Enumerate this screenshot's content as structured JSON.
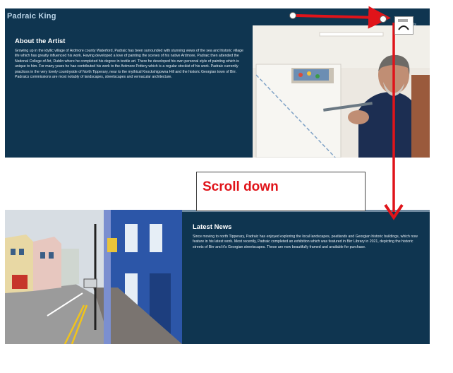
{
  "site": {
    "title": "Padraic King"
  },
  "nav": {
    "contact": "Contact Us"
  },
  "about": {
    "heading": "About the Artist",
    "text": "Growing up in the idyllic village of Ardmore county Waterford, Padraic has been surrounded with stunning views of the sea and historic village life which has greatly influenced his work. Having developed a love of painting the scenes of his native Ardmore, Padraic then attended the National College of Art, Dublin where he completed his degree in textile art. There he developed his own personal style of painting which is unique to him. For many years he has contributed his work to the Ardmore Pottery which is a regular stockist of his work. Padraic currently practices in the very lovely countryside of North Tipperary, near to the mythical Knockshigowna Hill and the historic Georgian town of Birr. Padraics commissions are most notably of landscapes, streetscapes and vernacular architecture."
  },
  "news": {
    "heading": "Latest News",
    "text": "Since moving to north Tipperary, Padraic has enjoyed exploring the local landscapes, peatlands and Georgian historic buildings, which now feature in his latest work. Most recently, Padraic completed an exhibition which was featured in Birr Library in 2021, depicting the historic streets of Birr and it's Georgian streetscapes. These are now beautifully framed and available for purchase."
  },
  "annotation": {
    "scroll_label": "Scroll down"
  },
  "colors": {
    "panel": "#0f3550",
    "arrow": "#e0141a"
  },
  "icons": {
    "cursor": "scroll-cursor-icon"
  }
}
